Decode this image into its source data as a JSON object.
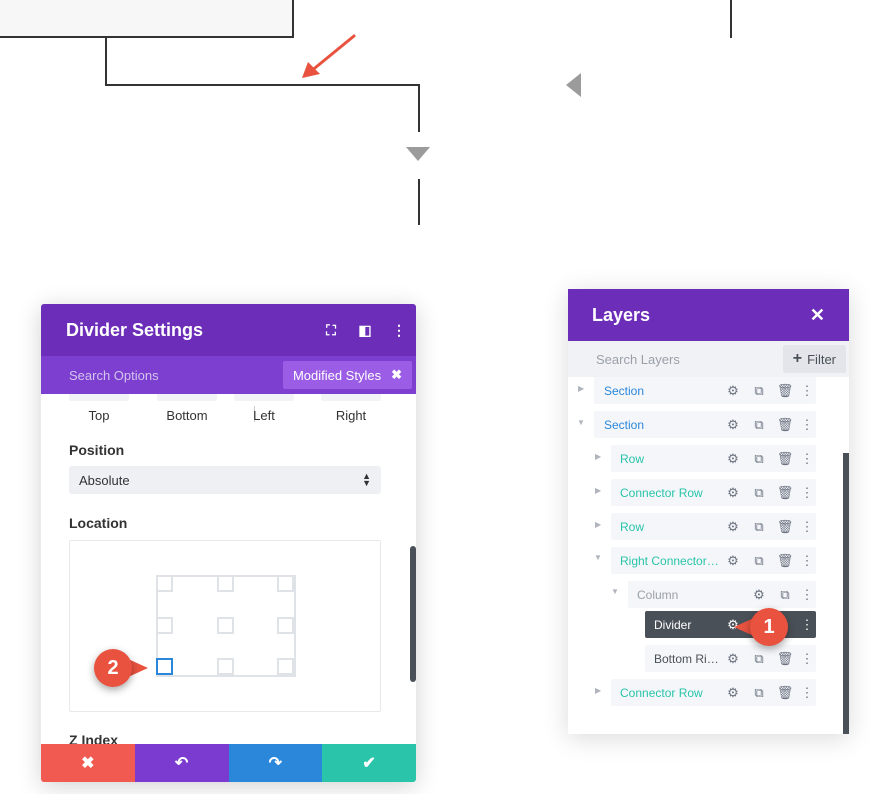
{
  "settings": {
    "title": "Divider Settings",
    "search_placeholder": "Search Options",
    "modified_styles": "Modified Styles",
    "modified_close": "✖",
    "icons": {
      "expand": "⛶",
      "split": "◧",
      "more": "⋮"
    },
    "sides": [
      "Top",
      "Bottom",
      "Left",
      "Right"
    ],
    "position_label": "Position",
    "position_value": "Absolute",
    "location_label": "Location",
    "zindex_label": "Z Index",
    "footer": {
      "cancel": "✖",
      "undo": "↶",
      "redo": "↷",
      "save": "✔"
    }
  },
  "badges": {
    "one": "1",
    "two": "2"
  },
  "layers": {
    "title": "Layers",
    "close": "✕",
    "search_placeholder": "Search Layers",
    "filter_label": "Filter",
    "filter_plus": "+",
    "items": [
      {
        "label": "Section",
        "type": "section"
      },
      {
        "label": "Section",
        "type": "section"
      },
      {
        "label": "Row",
        "type": "rowtype"
      },
      {
        "label": "Connector Row",
        "type": "rowtype"
      },
      {
        "label": "Row",
        "type": "rowtype"
      },
      {
        "label": "Right Connector Row",
        "type": "rowtype"
      },
      {
        "label": "Column",
        "type": "column"
      },
      {
        "label": "Divider",
        "type": "module"
      },
      {
        "label": "Bottom Right Divider",
        "type": "module"
      },
      {
        "label": "Connector Row",
        "type": "rowtype"
      }
    ],
    "ctrl_icons": {
      "settings": "⚙",
      "duplicate": "⧉",
      "delete": "🗑",
      "more": "⋮"
    }
  },
  "colors": {
    "purple": "#6c2eb9",
    "purple_light": "#7d3fd0",
    "red": "#f05a50",
    "violet": "#7b3bd1",
    "blue": "#2b87da",
    "green": "#29c4a9",
    "badge": "#e8523f"
  }
}
